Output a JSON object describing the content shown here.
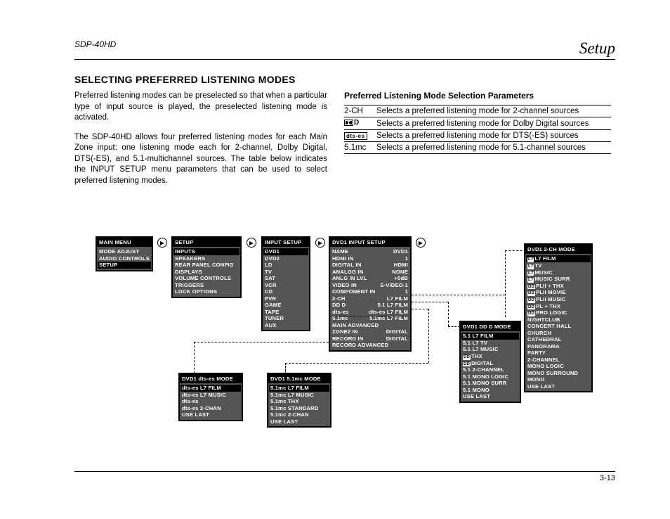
{
  "header": {
    "model": "SDP-40HD",
    "section": "Setup"
  },
  "heading": "SELECTING PREFERRED LISTENING MODES",
  "text": {
    "p1": "Preferred listening modes can be preselected so that when a particular type of input source is played, the preselected listening mode is activated.",
    "p2": "The SDP-40HD allows four preferred listening modes for each Main Zone input: one listening mode each for 2-channel, Dolby Digital, DTS(-ES), and 5.1-multichannel sources. The table below indicates the INPUT SETUP menu parameters that can be used to select preferred listening modes."
  },
  "params": {
    "title": "Preferred Listening Mode Selection Parameters",
    "rows": [
      {
        "label": "2-CH",
        "desc": "Selects a preferred listening mode for 2-channel sources"
      },
      {
        "label": "doldD",
        "desc": "Selects a preferred listening mode for Dolby Digital sources"
      },
      {
        "label": "dts-es",
        "desc": "Selects a preferred listening mode for DTS(-ES) sources"
      },
      {
        "label": "5.1mc",
        "desc": "Selects a preferred listening mode for 5.1-channel sources"
      }
    ]
  },
  "menus": {
    "main": {
      "title": "MAIN MENU",
      "items": [
        "MODE ADJUST",
        "AUDIO CONTROLS"
      ],
      "highlight": "SETUP",
      "after": []
    },
    "setup": {
      "title": "SETUP",
      "highlight": "INPUTS",
      "items": [
        "SPEAKERS",
        "REAR PANEL CONFIG",
        "DISPLAYS",
        "VOLUME CONTROLS",
        "TRIGGERS",
        "LOCK OPTIONS"
      ]
    },
    "input": {
      "title": "INPUT SETUP",
      "highlight": "DVD1",
      "items": [
        "DVD2",
        "LD",
        "TV",
        "SAT",
        "VCR",
        "CD",
        "PVR",
        "GAME",
        "TAPE",
        "TUNER",
        "AUX"
      ]
    },
    "dvd1": {
      "title": "DVD1 INPUT SETUP",
      "rows": [
        [
          "NAME",
          "DVD1"
        ],
        [
          "HDMI IN",
          "1"
        ],
        [
          "DIGITAL IN",
          "HDMI"
        ],
        [
          "ANALOG IN",
          "NONE"
        ],
        [
          "ANLG IN LVL",
          "+0dB"
        ],
        [
          "VIDEO IN",
          "S-VIDEO-1"
        ],
        [
          "COMPONENT IN",
          "1"
        ],
        [
          "2-CH",
          "L7 FILM"
        ],
        [
          "DD D",
          "5.1 L7 FILM"
        ],
        [
          "dts-es",
          "dts-es L7 FILM"
        ],
        [
          "5.1mc",
          "5.1mc L7 FILM"
        ],
        [
          "MAIN ADVANCED",
          ""
        ],
        [
          "ZONE2 IN",
          "DIGITAL"
        ],
        [
          "RECORD IN",
          "DIGITAL"
        ],
        [
          "RECORD ADVANCED",
          ""
        ]
      ]
    },
    "dts": {
      "title": "DVD1 dts-es MODE",
      "hl": "dts-es L7 FILM",
      "items": [
        "dts-es L7 MUSIC",
        "dts-es",
        "dts-es 2-CHAN",
        "USE LAST"
      ]
    },
    "mc": {
      "title": "DVD1 5.1mc MODE",
      "hl": "5.1mc L7 FILM",
      "items": [
        "5.1mc L7 MUSIC",
        "5.1mc THX",
        "5.1mc STANDARD",
        "5.1mc 2-CHAN",
        "USE LAST"
      ]
    },
    "dd": {
      "title": "DVD1 DD D MODE",
      "hl": "5.1 L7 FILM",
      "items": [
        "5.1 L7 TV",
        "5.1 L7 MUSIC",
        "DD THX",
        "DD DIGITAL",
        "5.1 2-CHANNEL",
        "5.1 MONO LOGIC",
        "5.1 MONO SURR",
        "5.1 MONO",
        "USE LAST"
      ]
    },
    "ch2": {
      "title": "DVD1 2-CH MODE",
      "hl": "L7 FILM",
      "items": [
        "L7 TV",
        "L7 MUSIC",
        "L7 MUSIC SURR",
        "DD PLII + THX",
        "DD PLII MOVIE",
        "DD PLII MUSIC",
        "DD PL + THX",
        "DD PRO LOGIC",
        "NIGHTCLUB",
        "CONCERT HALL",
        "CHURCH",
        "CATHEDRAL",
        "PANORAMA",
        "PARTY",
        "2-CHANNEL",
        "MONO LOGIC",
        "MONO SURROUND",
        "MONO",
        "USE LAST"
      ]
    }
  },
  "footer": "3-13"
}
